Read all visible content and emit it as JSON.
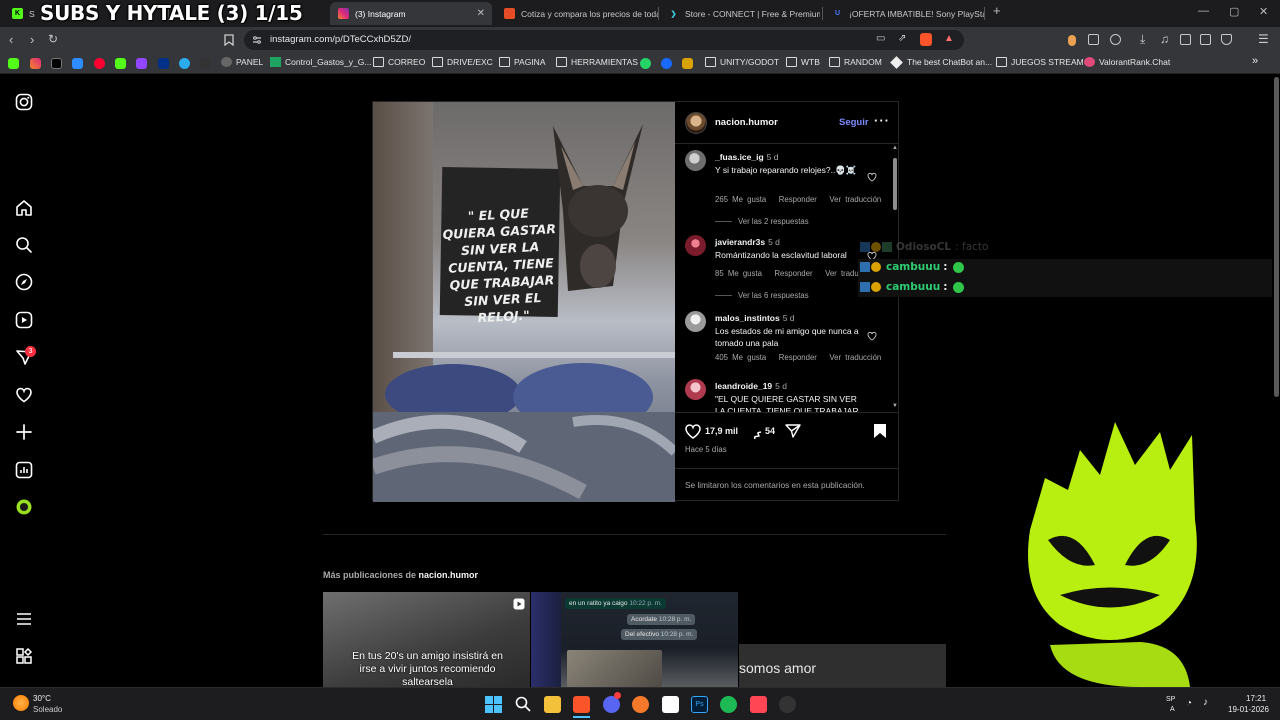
{
  "overlay": {
    "stream_title": "SUBS Y HYTALE (3) 1/15"
  },
  "browser": {
    "tabs": [
      {
        "label": "S",
        "fav_color": "#53fc18"
      },
      {
        "label": "(3) Instagram",
        "fav_color": "#e1306c",
        "active": true
      },
      {
        "label": "Cotiza y compara los precios de toda",
        "fav_color": "#e44d26"
      },
      {
        "label": "Store - CONNECT | Free & Premium",
        "fav_color": "#3b82f6"
      },
      {
        "label": "¡OFERTA IMBATIBLE! Sony PlayStation",
        "fav_color": "#2563eb"
      }
    ],
    "new_tab": "+",
    "url": "instagram.com/p/DTeCCxhD5ZD/",
    "bookmarks": [
      {
        "label": "PANEL",
        "icon": "panel-icon"
      },
      {
        "label": "Control_Gastos_y_G...",
        "icon": "sheets-icon"
      },
      {
        "label": "CORREO",
        "icon": "folder-icon"
      },
      {
        "label": "DRIVE/EXC",
        "icon": "folder-icon"
      },
      {
        "label": "PAGINA",
        "icon": "folder-icon"
      },
      {
        "label": "HERRAMIENTAS",
        "icon": "folder-icon"
      },
      {
        "label": "UNITY/GODOT",
        "icon": "folder-icon"
      },
      {
        "label": "WTB",
        "icon": "folder-icon"
      },
      {
        "label": "RANDOM",
        "icon": "folder-icon"
      },
      {
        "label": "The best ChatBot an...",
        "icon": "chatbot-icon"
      },
      {
        "label": "JUEGOS STREAM",
        "icon": "folder-icon"
      },
      {
        "label": "ValorantRank.Chat",
        "icon": "valorant-icon"
      }
    ],
    "overflow": "»"
  },
  "post": {
    "image_sign_text": "\" EL QUE QUIERA GASTAR SIN VER LA CUENTA, TIENE QUE TRABAJAR SIN VER EL RELOJ.\"",
    "author": "nacion.humor",
    "follow": "Seguir",
    "more": "•••",
    "comments": [
      {
        "user": "_fuas.ice_ig",
        "age": "5 d",
        "text": "Y si trabajo reparando relojes?..💀☠️",
        "likes": "265 Me gusta",
        "reply": "Responder",
        "translate": "Ver traducción",
        "replies": "Ver las 2 respuestas",
        "avatar_color": "#9a9a9a"
      },
      {
        "user": "javierandr3s",
        "age": "5 d",
        "text": "Romántizando la esclavitud laboral",
        "likes": "85 Me gusta",
        "reply": "Responder",
        "translate": "Ver traducción",
        "replies": "Ver las 6 respuestas",
        "avatar_color": "#b0384a"
      },
      {
        "user": "malos_instintos",
        "age": "5 d",
        "text": "Los estados de mi amigo que nunca a tomado una pala",
        "likes": "405 Me gusta",
        "reply": "Responder",
        "translate": "Ver traducción",
        "replies": "",
        "avatar_color": "#cfcfcf"
      },
      {
        "user": "leandroide_19",
        "age": "5 d",
        "text": "\"EL QUE QUIERE GASTAR SIN VER LA CUENTA, TIENE QUE TRABAJAR",
        "likes": "",
        "reply": "",
        "translate": "",
        "replies": "",
        "avatar_color": "#c9475b"
      }
    ],
    "like_count": "17,9 mil",
    "comment_count": "54",
    "posted": "Hace 5 días",
    "limited_notice": "Se limitaron los comentarios en esta publicación."
  },
  "more_posts": {
    "prefix": "Más publicaciones de",
    "author": "nacion.humor",
    "thumb1_caption": "En tus 20's un amigo insistirá en irse a vivir juntos recomiendo saltearsela",
    "thumb2_lines": [
      "en un ratito ya caigo",
      "Acordate",
      "Del efectivo"
    ],
    "thumb2_times": [
      "10:22 p. m.",
      "10:28 p. m.",
      "10:28 p. m."
    ],
    "thumb3_caption": "somos amor"
  },
  "chat": [
    {
      "user": "OdiosoCL",
      "text": ": facto",
      "color": "#5a5a5a"
    },
    {
      "user": "cambuuu",
      "text": ":",
      "color": "#2ecc71"
    },
    {
      "user": "cambuuu",
      "text": ":",
      "color": "#2ecc71"
    }
  ],
  "sidebar_badge": "3",
  "taskbar": {
    "weather_temp": "30°C",
    "weather_desc": "Soleado",
    "time": "17:21",
    "date": "19-01-2026",
    "lang": "SP",
    "lang2": "A"
  }
}
